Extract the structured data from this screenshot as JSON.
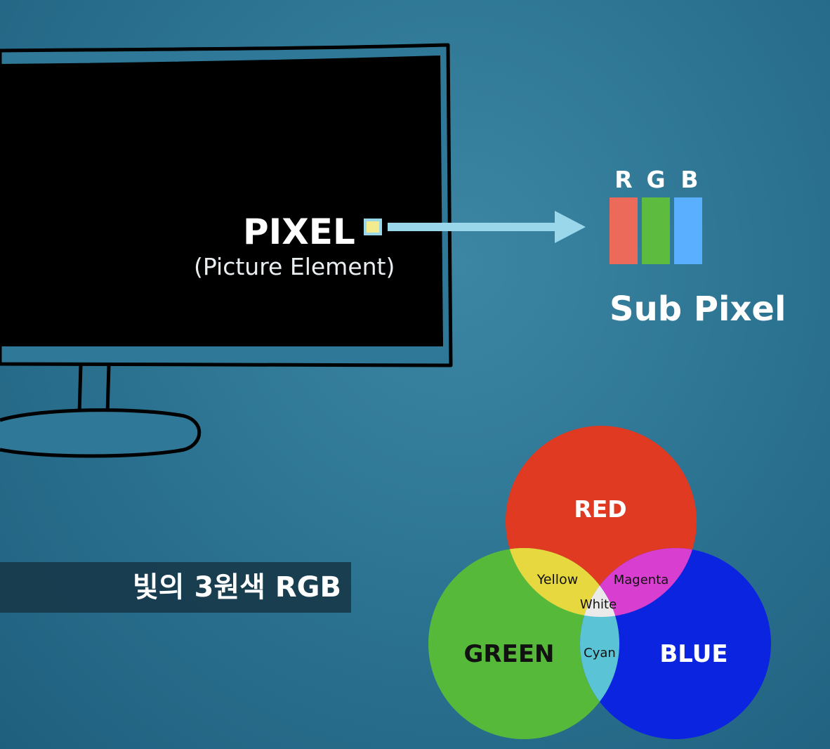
{
  "pixel": {
    "title": "PIXEL",
    "subtitle": "(Picture Element)"
  },
  "subpixel": {
    "letters": [
      "R",
      "G",
      "B"
    ],
    "colors": [
      "#ec6a5a",
      "#5dbb40",
      "#5aafff"
    ],
    "label": "Sub Pixel"
  },
  "caption": {
    "text": "빛의 3원색 RGB"
  },
  "venn": {
    "primaries": [
      {
        "label": "RED",
        "color": "#e03a22"
      },
      {
        "label": "GREEN",
        "color": "#56b93a"
      },
      {
        "label": "BLUE",
        "color": "#0a24e0"
      }
    ],
    "overlaps": [
      {
        "label": "Yellow",
        "color": "#e8d840"
      },
      {
        "label": "Magenta",
        "color": "#d83fd0"
      },
      {
        "label": "Cyan",
        "color": "#5ac4d6"
      },
      {
        "label": "White",
        "color": "#eaeaea"
      }
    ]
  },
  "colors": {
    "background": "#2d7593",
    "monitor_screen": "#000000",
    "outline": "#000000",
    "arrow": "#9ad7ea",
    "pixel_marker": "#f2ec8e",
    "caption_bar": "#173a4b"
  }
}
